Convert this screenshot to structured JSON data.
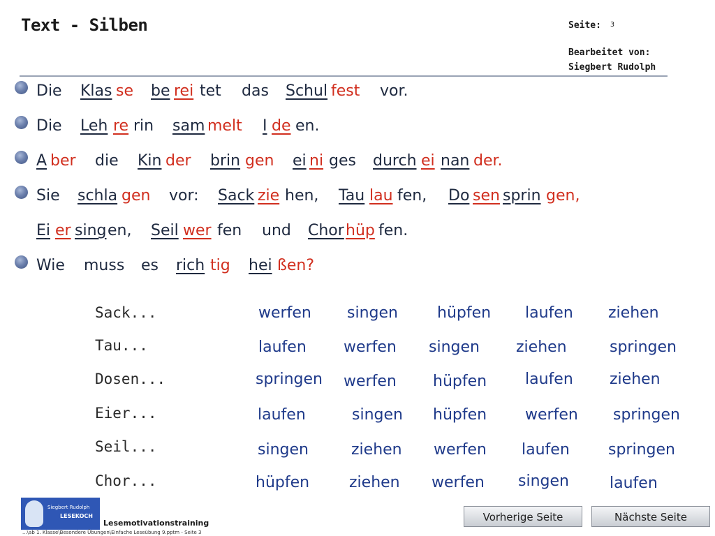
{
  "header": {
    "title": "Text - Silben",
    "page_label": "Seite:",
    "page_number": "3",
    "edited_label": "Bearbeitet von:",
    "author": "Siegbert Rudolph"
  },
  "text_lines": [
    [
      {
        "t": "Die",
        "c": "b",
        "u": false
      },
      {
        "t": "Klas",
        "c": "b",
        "u": true
      },
      {
        "t": "se",
        "c": "r",
        "u": false
      },
      {
        "t": "be",
        "c": "b",
        "u": true
      },
      {
        "t": "rei",
        "c": "r",
        "u": true
      },
      {
        "t": "tet",
        "c": "b",
        "u": false
      },
      {
        "t": "das",
        "c": "b",
        "u": false
      },
      {
        "t": "Schul",
        "c": "b",
        "u": true
      },
      {
        "t": "fest",
        "c": "r",
        "u": false
      },
      {
        "t": "vor.",
        "c": "b",
        "u": false
      }
    ],
    [
      {
        "t": "Die",
        "c": "b",
        "u": false
      },
      {
        "t": "Leh",
        "c": "b",
        "u": true
      },
      {
        "t": "re",
        "c": "r",
        "u": true
      },
      {
        "t": "rin",
        "c": "b",
        "u": false
      },
      {
        "t": "sam",
        "c": "b",
        "u": true
      },
      {
        "t": "melt",
        "c": "r",
        "u": false
      },
      {
        "t": "I",
        "c": "b",
        "u": true
      },
      {
        "t": "de",
        "c": "r",
        "u": true
      },
      {
        "t": "en.",
        "c": "b",
        "u": false
      }
    ],
    [
      {
        "t": "A",
        "c": "b",
        "u": true
      },
      {
        "t": "ber",
        "c": "r",
        "u": false
      },
      {
        "t": "die",
        "c": "b",
        "u": false
      },
      {
        "t": "Kin",
        "c": "b",
        "u": true
      },
      {
        "t": "der",
        "c": "r",
        "u": false
      },
      {
        "t": "brin",
        "c": "b",
        "u": true
      },
      {
        "t": "gen",
        "c": "r",
        "u": false
      },
      {
        "t": "ei",
        "c": "b",
        "u": true
      },
      {
        "t": "ni",
        "c": "r",
        "u": true
      },
      {
        "t": "ges",
        "c": "b",
        "u": false
      },
      {
        "t": "durch",
        "c": "b",
        "u": true
      },
      {
        "t": "ei",
        "c": "r",
        "u": true
      },
      {
        "t": "nan",
        "c": "b",
        "u": true
      },
      {
        "t": "der.",
        "c": "r",
        "u": false
      }
    ],
    [
      {
        "t": "Sie",
        "c": "b",
        "u": false
      },
      {
        "t": "schla",
        "c": "b",
        "u": true
      },
      {
        "t": "gen",
        "c": "r",
        "u": false
      },
      {
        "t": "vor:",
        "c": "b",
        "u": false
      },
      {
        "t": "Sack",
        "c": "b",
        "u": true
      },
      {
        "t": "zie",
        "c": "r",
        "u": true
      },
      {
        "t": "hen,",
        "c": "b",
        "u": false
      },
      {
        "t": "Tau",
        "c": "b",
        "u": true
      },
      {
        "t": "lau",
        "c": "r",
        "u": true
      },
      {
        "t": "fen,",
        "c": "b",
        "u": false
      },
      {
        "t": "Do",
        "c": "b",
        "u": true
      },
      {
        "t": "sen",
        "c": "r",
        "u": true
      },
      {
        "t": "sprin",
        "c": "b",
        "u": true
      },
      {
        "t": "gen,",
        "c": "r",
        "u": false
      }
    ],
    [
      {
        "t": "Ei",
        "c": "b",
        "u": true
      },
      {
        "t": "er",
        "c": "r",
        "u": true
      },
      {
        "t": "sing",
        "c": "b",
        "u": true
      },
      {
        "t": "en,",
        "c": "b",
        "u": false
      },
      {
        "t": "Seil",
        "c": "b",
        "u": true
      },
      {
        "t": "wer",
        "c": "r",
        "u": true
      },
      {
        "t": "fen",
        "c": "b",
        "u": false
      },
      {
        "t": "und",
        "c": "b",
        "u": false
      },
      {
        "t": "Chor",
        "c": "b",
        "u": true
      },
      {
        "t": "hüp",
        "c": "r",
        "u": true
      },
      {
        "t": "fen.",
        "c": "b",
        "u": false
      }
    ],
    [
      {
        "t": "Wie",
        "c": "b",
        "u": false
      },
      {
        "t": "muss",
        "c": "b",
        "u": false
      },
      {
        "t": "es",
        "c": "b",
        "u": false
      },
      {
        "t": "rich",
        "c": "b",
        "u": true
      },
      {
        "t": "tig",
        "c": "r",
        "u": false
      },
      {
        "t": "hei",
        "c": "b",
        "u": true
      },
      {
        "t": "ßen?",
        "c": "r",
        "u": false
      }
    ]
  ],
  "questions": [
    {
      "label": "Sack...",
      "options": [
        "werfen",
        "singen",
        "hüpfen",
        "laufen",
        "ziehen"
      ]
    },
    {
      "label": "Tau...",
      "options": [
        "laufen",
        "werfen",
        "singen",
        "ziehen",
        "springen"
      ]
    },
    {
      "label": "Dosen...",
      "options": [
        "springen",
        "werfen",
        "hüpfen",
        "laufen",
        "ziehen"
      ]
    },
    {
      "label": "Eier...",
      "options": [
        "laufen",
        "singen",
        "hüpfen",
        "werfen",
        "springen"
      ]
    },
    {
      "label": "Seil...",
      "options": [
        "singen",
        "ziehen",
        "werfen",
        "laufen",
        "springen"
      ]
    },
    {
      "label": "Chor...",
      "options": [
        "hüpfen",
        "ziehen",
        "werfen",
        "singen",
        "laufen"
      ]
    }
  ],
  "logo": {
    "line1": "Siegbert Rudolph",
    "line2": "LESEKOCH"
  },
  "footer": {
    "program": "Lesemotivationstraining",
    "path": "...\\ab 1. Klasse\\Besondere Übungen\\Einfache Leseübung 9.pptm - Seite 3"
  },
  "nav": {
    "prev": "Vorherige Seite",
    "next": "Nächste Seite"
  },
  "colors": {
    "syllable_dark": "#1f2a40",
    "syllable_red": "#d12f1f",
    "option_blue": "#1f3a8a"
  }
}
